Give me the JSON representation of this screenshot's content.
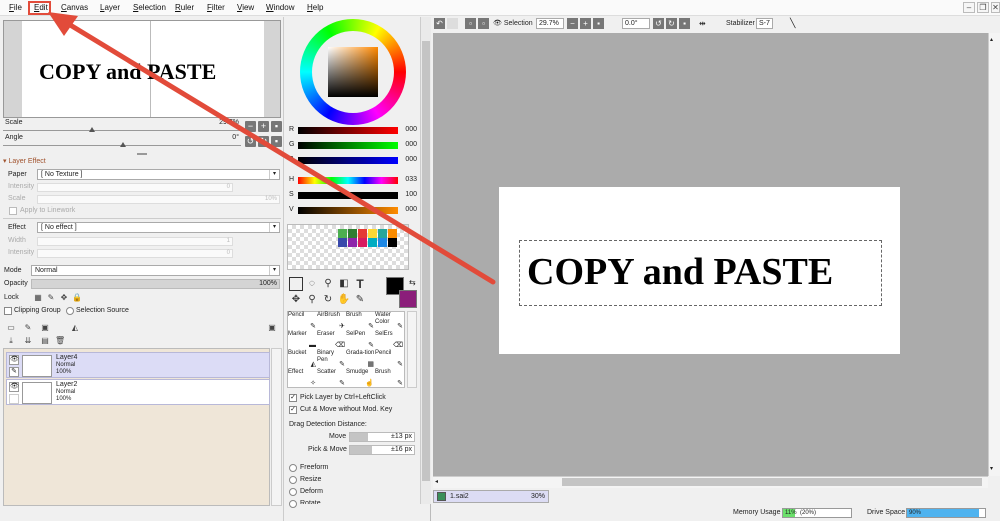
{
  "menu": [
    "File",
    "Edit",
    "Canvas",
    "Layer",
    "Selection",
    "Ruler",
    "Filter",
    "View",
    "Window",
    "Help"
  ],
  "navigator": {
    "preview_text": "COPY and PASTE",
    "scale_label": "Scale",
    "scale_value": "29.7%",
    "angle_label": "Angle",
    "angle_value": "0°"
  },
  "layer_effect": {
    "header": "Layer Effect",
    "paper_label": "Paper",
    "paper_value": "[ No Texture ]",
    "intensity_label": "Intensity",
    "intensity_value": "0",
    "scale_label": "Scale",
    "scale_value": "10%",
    "apply_label": "Apply to Linework",
    "effect_label": "Effect",
    "effect_value": "[ No effect ]",
    "width_label": "Width",
    "width_value": "1",
    "intensity2_label": "Intensity",
    "intensity2_value": "0"
  },
  "layer_props": {
    "mode_label": "Mode",
    "mode_value": "Normal",
    "opacity_label": "Opacity",
    "opacity_value": "100%",
    "lock_label": "Lock",
    "clipping_label": "Clipping Group",
    "selection_source_label": "Selection Source"
  },
  "layers": [
    {
      "name": "Layer4",
      "mode": "Normal",
      "opacity": "100%"
    },
    {
      "name": "Layer2",
      "mode": "Normal",
      "opacity": "100%"
    }
  ],
  "color": {
    "r_label": "R",
    "r_value": "000",
    "g_label": "G",
    "g_value": "000",
    "b_label": "B",
    "b_value": "000",
    "h_label": "H",
    "h_value": "033",
    "s_label": "S",
    "s_value": "100",
    "v_label": "V",
    "v_value": "000",
    "fg": "#000000",
    "bg": "#8b1e7a"
  },
  "brushes": [
    "Pencil",
    "AirBrush",
    "Brush",
    "Water Color",
    "Marker",
    "Eraser",
    "SelPen",
    "SelErs",
    "Bucket",
    "Binary Pen",
    "Grada-tion",
    "Pencil",
    "Effect",
    "Scatter",
    "Smudge",
    "Brush"
  ],
  "options": {
    "pick_layer": "Pick Layer by Ctrl+LeftClick",
    "cut_move": "Cut & Move without Mod. Key",
    "drag_label": "Drag Detection Distance:",
    "move_label": "Move",
    "move_value": "±13 px",
    "pickmove_label": "Pick & Move",
    "pickmove_value": "±16 px",
    "transforms": [
      "Freeform",
      "Resize",
      "Deform",
      "Rotate"
    ]
  },
  "toolbar": {
    "selection_label": "Selection",
    "zoom_value": "29.7%",
    "angle_value": "0.0°",
    "stabilizer_label": "Stabilizer",
    "stabilizer_value": "S-7"
  },
  "canvas": {
    "text": "COPY and PASTE"
  },
  "doc_tab": {
    "name": "1.sai2",
    "zoom": "30%"
  },
  "status": {
    "memory_label": "Memory Usage",
    "memory_value": "11%",
    "memory_extra": "(20%)",
    "drive_label": "Drive Space",
    "drive_value": "90%"
  }
}
